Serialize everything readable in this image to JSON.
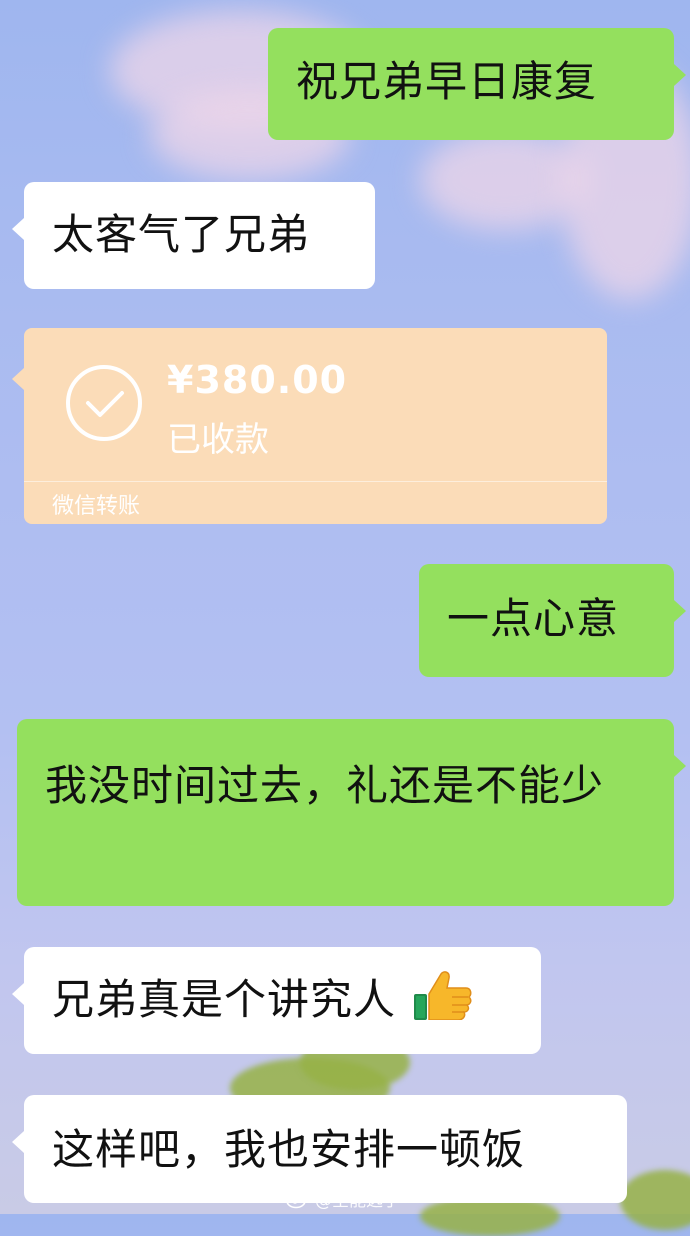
{
  "messages": [
    {
      "side": "right",
      "text": "祝兄弟早日康复"
    },
    {
      "side": "left",
      "text": "太客气了兄弟"
    },
    {
      "side": "right",
      "text": "一点心意"
    },
    {
      "side": "right",
      "text": "我没时间过去，礼还是不能少"
    },
    {
      "side": "left",
      "text": "兄弟真是个讲究人"
    },
    {
      "side": "left",
      "text": "这样吧，我也安排一顿饭"
    }
  ],
  "transfer": {
    "amount": "¥380.00",
    "status": "已收款",
    "label": "微信转账",
    "icon": "check-circle-icon"
  },
  "emoji": "thumbs-up-icon",
  "watermark": {
    "text": "@全能选手",
    "icon": "weibo-icon"
  },
  "colors": {
    "self_bubble": "#94e05e",
    "other_bubble": "#ffffff",
    "transfer_card": "#fbdcb8"
  }
}
